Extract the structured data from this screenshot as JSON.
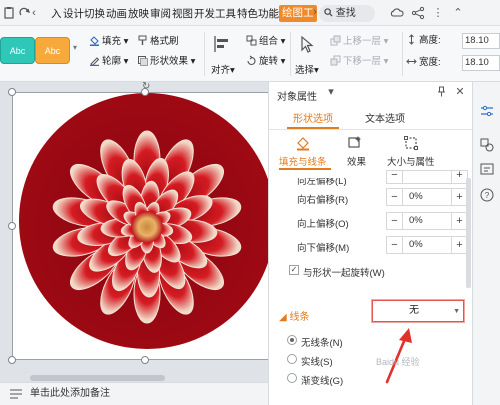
{
  "ribbon_tabs": [
    "入",
    "设计",
    "切换",
    "动画",
    "放映",
    "审阅",
    "视图",
    "开发工具",
    "特色功能",
    "绘图工"
  ],
  "search": {
    "label": "查找"
  },
  "ribbon": {
    "style_samples": [
      "Abc",
      "Abc"
    ],
    "fill_label": "填充",
    "format_brush_label": "格式刷",
    "outline_label": "轮廓",
    "shape_effect_label": "形状效果",
    "align_label": "对齐",
    "group_label": "组合",
    "rotate_label": "旋转",
    "select_label": "选择",
    "bring_forward_label": "上移一层",
    "send_backward_label": "下移一层",
    "height_label": "高度:",
    "height_value": "18.10",
    "width_label": "宽度:",
    "width_value": "18.10"
  },
  "status": {
    "notes_placeholder": "单击此处添加备注"
  },
  "pane": {
    "title": "对象属性",
    "tabs": [
      "形状选项",
      "文本选项"
    ],
    "subtabs": [
      "填充与线条",
      "效果",
      "大小与属性"
    ],
    "offset_rows": [
      {
        "label": "向左偏移(L)",
        "value": "0%"
      },
      {
        "label": "向右偏移(R)",
        "value": "0%"
      },
      {
        "label": "向上偏移(O)",
        "value": "0%"
      },
      {
        "label": "向下偏移(M)",
        "value": "0%"
      }
    ],
    "rotate_with_shape_label": "与形状一起旋转(W)",
    "line_section_title": "线条",
    "line_dropdown_value": "无",
    "line_options": [
      "无线条(N)",
      "实线(S)",
      "渐变线(G)"
    ]
  },
  "watermark": "Baidu 经验",
  "colors": {
    "accent": "#e47a1e",
    "tab_active": "#ef8a2b",
    "arrow": "#e2302a",
    "style1": "#2fc8b8",
    "style2": "#f7a93b"
  }
}
